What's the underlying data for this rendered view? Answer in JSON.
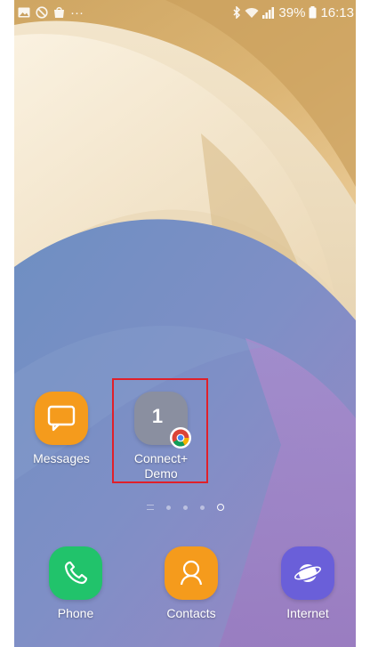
{
  "status_bar": {
    "notification_icons": [
      "gallery-icon",
      "blocked-icon",
      "bag-icon",
      "more-dots-icon"
    ],
    "more_text": "···",
    "battery_percent": "39%",
    "time": "16:13"
  },
  "home_apps": [
    {
      "id": "messages",
      "label": "Messages",
      "color": "#f59b1c"
    },
    {
      "id": "connect-demo",
      "label": "Connect+\nDemo",
      "tile_text": "1",
      "color": "#8a8fa0",
      "badge": "chrome-icon"
    }
  ],
  "page_indicator": {
    "pages": 4,
    "active": 4
  },
  "dock": [
    {
      "id": "phone",
      "label": "Phone",
      "color": "#21c36b"
    },
    {
      "id": "contacts",
      "label": "Contacts",
      "color": "#f59b1c"
    },
    {
      "id": "internet",
      "label": "Internet",
      "color": "#6a5fd9"
    }
  ]
}
